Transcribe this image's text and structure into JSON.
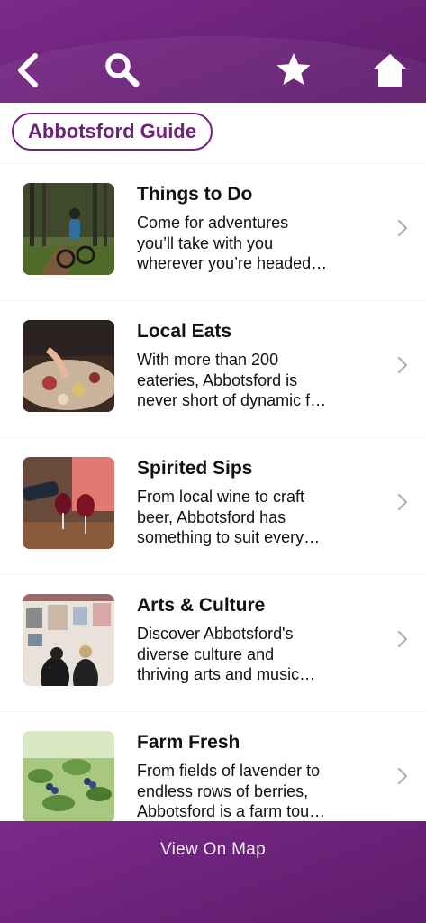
{
  "header": {
    "icons": {
      "back": "back-chevron-icon",
      "search": "search-icon",
      "favorite": "star-icon",
      "home": "home-icon"
    },
    "colors": {
      "brand": "#6e2279"
    }
  },
  "guide": {
    "label": "Abbotsford Guide"
  },
  "items": [
    {
      "title": "Things to Do",
      "desc": [
        "Come for adventures",
        "you’ll take with you",
        "wherever you’re headed…"
      ]
    },
    {
      "title": "Local Eats",
      "desc": [
        "With more than 200",
        "eateries, Abbotsford is",
        "never short of dynamic f…"
      ]
    },
    {
      "title": "Spirited Sips",
      "desc": [
        "From local wine to craft",
        "beer, Abbotsford has",
        "something to suit every…"
      ]
    },
    {
      "title": "Arts & Culture",
      "desc": [
        "Discover Abbotsford's",
        "diverse culture and",
        "thriving arts and music…"
      ]
    },
    {
      "title": "Farm Fresh",
      "desc": [
        "From fields of lavender to",
        "endless rows of berries,",
        "Abbotsford is a farm tou…"
      ]
    }
  ],
  "footer": {
    "map_label": "View On Map"
  }
}
